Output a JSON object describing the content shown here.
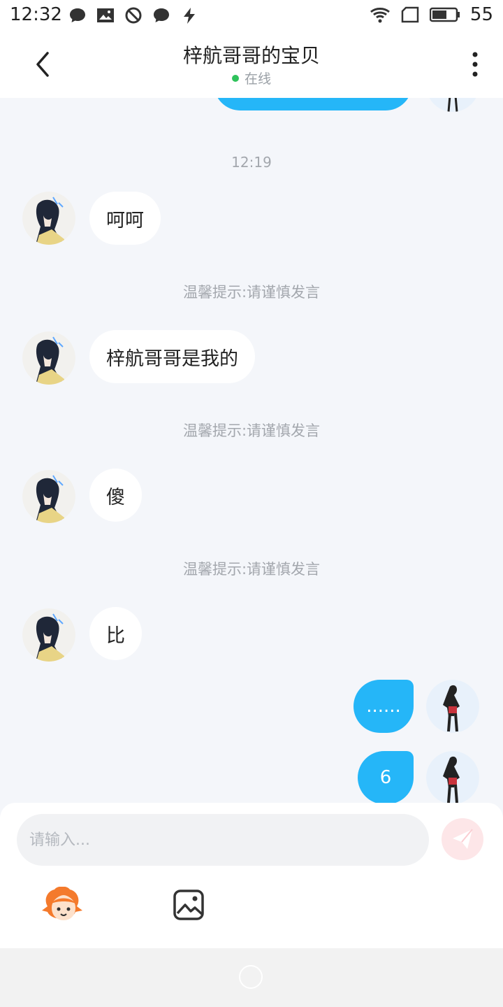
{
  "status_bar": {
    "time": "12:32",
    "battery": "55",
    "icons_left": [
      "chat-bubble-icon",
      "image-icon",
      "blocked-icon",
      "chat-bubble-icon",
      "flash-icon"
    ],
    "icons_right": [
      "wifi-icon",
      "sim-icon",
      "battery-icon"
    ]
  },
  "header": {
    "title": "梓航哥哥的宝贝",
    "status": "在线",
    "status_color": "#2fc25b"
  },
  "chat": {
    "timestamp": "12:19",
    "tip": "温馨提示:请谨慎发言",
    "incoming": [
      {
        "text": "呵呵"
      },
      {
        "text": "梓航哥哥是我的"
      },
      {
        "text": "傻"
      },
      {
        "text": "比"
      }
    ],
    "outgoing": [
      {
        "text": "......"
      },
      {
        "text": "6"
      }
    ],
    "bubble_color_out": "#25b6f8"
  },
  "composer": {
    "placeholder": "请输入...",
    "value": ""
  }
}
